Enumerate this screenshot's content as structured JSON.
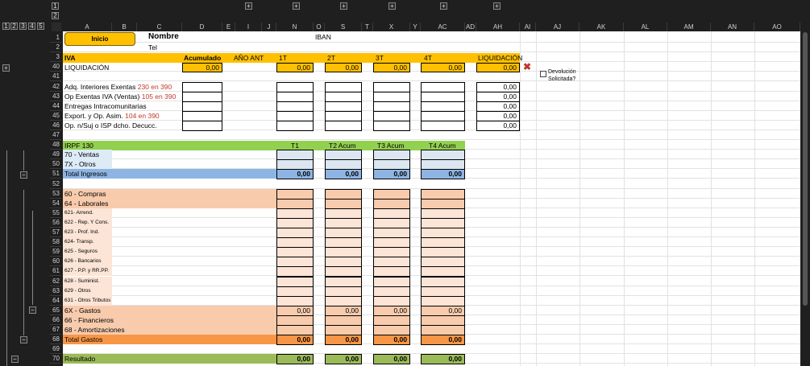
{
  "ui": {
    "expand": "+",
    "collapse": "−",
    "level_row_1": "1",
    "level_row_2": "2",
    "level_col_1": "1",
    "level_col_2": "2",
    "level_col_3": "3",
    "level_col_4": "4",
    "level_col_5": "5"
  },
  "columns": [
    "A",
    "B",
    "C",
    "D",
    "E",
    "I",
    "J",
    "N",
    "O",
    "S",
    "T",
    "X",
    "Y",
    "AC",
    "AD",
    "AH",
    "AI",
    "AJ",
    "AK",
    "AL",
    "AM",
    "AN",
    "AO"
  ],
  "rows": [
    "1",
    "2",
    "3",
    "40",
    "41",
    "42",
    "43",
    "44",
    "45",
    "46",
    "47",
    "48",
    "49",
    "50",
    "51",
    "52",
    "53",
    "54",
    "55",
    "56",
    "57",
    "58",
    "59",
    "60",
    "61",
    "62",
    "63",
    "64",
    "65",
    "66",
    "67",
    "68",
    "69",
    "70"
  ],
  "top": {
    "inicio": "Inicio",
    "nombre": "Nombre",
    "tel": "Tel",
    "iban": "IBAN"
  },
  "iva": {
    "title": "IVA",
    "headers": [
      "Acumulado",
      "AÑO ANT",
      "1T",
      "2T",
      "3T",
      "4T",
      "LIQUIDACIÓN"
    ],
    "liquidacion": {
      "label": "LIQUIDACIÓN",
      "acumulado": "0,00",
      "q1": "0,00",
      "q2": "0,00",
      "q3": "0,00",
      "q4": "0,00",
      "total": "0,00"
    },
    "devolucion_1": "Devolución",
    "devolucion_2": "Solicitada?",
    "detail": [
      {
        "label": "Adq. Interiores Exentas ",
        "ref": "230 en 390",
        "total": "0,00"
      },
      {
        "label": "Op Exentas IVA (Ventas) ",
        "ref": "105 en 390",
        "total": "0,00"
      },
      {
        "label": "Entregas Intracomunitarias",
        "ref": "",
        "total": "0,00"
      },
      {
        "label": "Export. y Op. Asim. ",
        "ref": "104 en 390",
        "total": "0,00"
      },
      {
        "label": "Op. n/Suj o ISP dcho. Decucc.",
        "ref": "",
        "total": "0,00"
      }
    ]
  },
  "irpf": {
    "title": "IRPF 130",
    "headers": [
      "T1",
      "T2 Acum",
      "T3 Acum",
      "T4 Acum"
    ],
    "body": [
      {
        "label": "70 - Ventas",
        "style": "income",
        "values": [
          "",
          "",
          "",
          ""
        ]
      },
      {
        "label": "7X - Otros",
        "style": "income",
        "values": [
          "",
          "",
          "",
          ""
        ]
      },
      {
        "label": "Total Ingresos",
        "style": "income-total",
        "values": [
          "0,00",
          "0,00",
          "0,00",
          "0,00"
        ]
      },
      {
        "label": "",
        "style": "blank",
        "values": []
      },
      {
        "label": "60 - Compras",
        "style": "expense",
        "values": [
          "",
          "",
          "",
          ""
        ]
      },
      {
        "label": "64 - Laborales",
        "style": "expense",
        "values": [
          "",
          "",
          "",
          ""
        ]
      },
      {
        "label": "621- Arrend.",
        "style": "sub",
        "values": [
          "",
          "",
          "",
          ""
        ]
      },
      {
        "label": "622 - Rep. Y Cons.",
        "style": "sub",
        "values": [
          "",
          "",
          "",
          ""
        ]
      },
      {
        "label": "623 - Prof. Ind.",
        "style": "sub",
        "values": [
          "",
          "",
          "",
          ""
        ]
      },
      {
        "label": "624- Transp.",
        "style": "sub",
        "values": [
          "",
          "",
          "",
          ""
        ]
      },
      {
        "label": "625 - Seguros",
        "style": "sub",
        "values": [
          "",
          "",
          "",
          ""
        ]
      },
      {
        "label": "626 - Bancarios",
        "style": "sub",
        "values": [
          "",
          "",
          "",
          ""
        ]
      },
      {
        "label": "627 - P.P. y RR.PP.",
        "style": "sub",
        "values": [
          "",
          "",
          "",
          ""
        ]
      },
      {
        "label": "628 - Suminist.",
        "style": "sub",
        "values": [
          "",
          "",
          "",
          ""
        ]
      },
      {
        "label": "629 - Otros",
        "style": "sub",
        "values": [
          "",
          "",
          "",
          ""
        ]
      },
      {
        "label": "631 - Otros Tributos",
        "style": "sub",
        "values": [
          "",
          "",
          "",
          ""
        ]
      },
      {
        "label": "6X - Gastos",
        "style": "expense",
        "values": [
          "0,00",
          "0,00",
          "0,00",
          "0,00"
        ]
      },
      {
        "label": "66 - Financieros",
        "style": "expense",
        "values": [
          "",
          "",
          "",
          ""
        ]
      },
      {
        "label": "68 - Amortizaciones",
        "style": "expense",
        "values": [
          "",
          "",
          "",
          ""
        ]
      },
      {
        "label": "Total Gastos",
        "style": "expense-total",
        "values": [
          "0,00",
          "0,00",
          "0,00",
          "0,00"
        ]
      },
      {
        "label": "",
        "style": "blank",
        "values": []
      },
      {
        "label": "Resultado",
        "style": "result",
        "values": [
          "0,00",
          "0,00",
          "0,00",
          "0,00"
        ]
      }
    ]
  }
}
